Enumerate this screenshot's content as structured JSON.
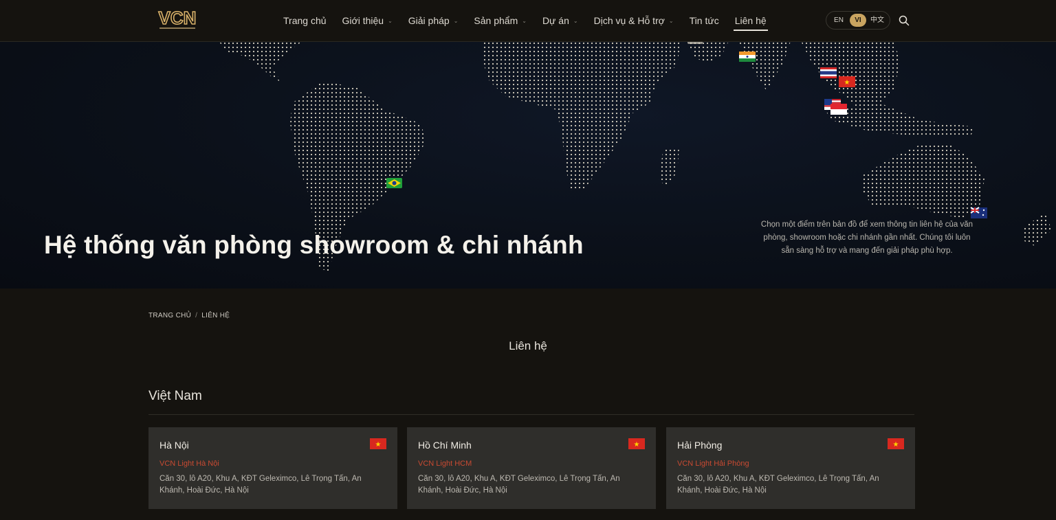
{
  "header": {
    "logo_alt": "VCN",
    "nav": [
      {
        "label": "Trang chủ",
        "has_dropdown": false,
        "active": false
      },
      {
        "label": "Giới thiệu",
        "has_dropdown": true,
        "active": false
      },
      {
        "label": "Giải pháp",
        "has_dropdown": true,
        "active": false
      },
      {
        "label": "Sản phẩm",
        "has_dropdown": true,
        "active": false
      },
      {
        "label": "Dự án",
        "has_dropdown": true,
        "active": false
      },
      {
        "label": "Dịch vụ & Hỗ trợ",
        "has_dropdown": true,
        "active": false
      },
      {
        "label": "Tin tức",
        "has_dropdown": false,
        "active": false
      },
      {
        "label": "Liên hệ",
        "has_dropdown": false,
        "active": true
      }
    ],
    "languages": [
      "EN",
      "VI",
      "中文"
    ],
    "selected_language": "VI",
    "search_icon": "search-icon"
  },
  "hero": {
    "title": "Hệ thống văn phòng showroom & chi nhánh",
    "description": "Chọn một điểm trên bản đồ để xem thông tin liên hệ của văn phòng, showroom hoặc chi nhánh gần nhất. Chúng tôi luôn sẵn sàng hỗ trợ và mang đến giải pháp phù hợp.",
    "map_flags": [
      "brazil-flag",
      "india-flag",
      "thailand-flag",
      "vietnam-flag",
      "malaysia-flag",
      "singapore-flag",
      "australia-flag"
    ]
  },
  "breadcrumb": {
    "home": "TRANG CHỦ",
    "separator": "/",
    "current": "LIÊN HỆ"
  },
  "section_title": "Liên hệ",
  "country": "Việt Nam",
  "offices": [
    {
      "city": "Hà Nội",
      "branch": "VCN Light Hà Nội",
      "address": "Căn 30, lô A20, Khu A, KĐT Geleximco, Lê Trọng Tấn, An Khánh, Hoài Đức, Hà Nội"
    },
    {
      "city": "Hồ Chí Minh",
      "branch": "VCN Light HCM",
      "address": "Căn 30, lô A20, Khu A, KĐT Geleximco, Lê Trọng Tấn, An Khánh, Hoài Đức, Hà Nội"
    },
    {
      "city": "Hải Phòng",
      "branch": "VCN Light Hải Phòng",
      "address": "Căn 30, lô A20, Khu A, KĐT Geleximco, Lê Trọng Tấn, An Khánh, Hoài Đức, Hà Nội"
    }
  ],
  "colors": {
    "accent_gold": "#c9a460",
    "branch_red": "#c84a32",
    "card_bg": "#2f2e2b",
    "page_bg": "#15130f"
  }
}
